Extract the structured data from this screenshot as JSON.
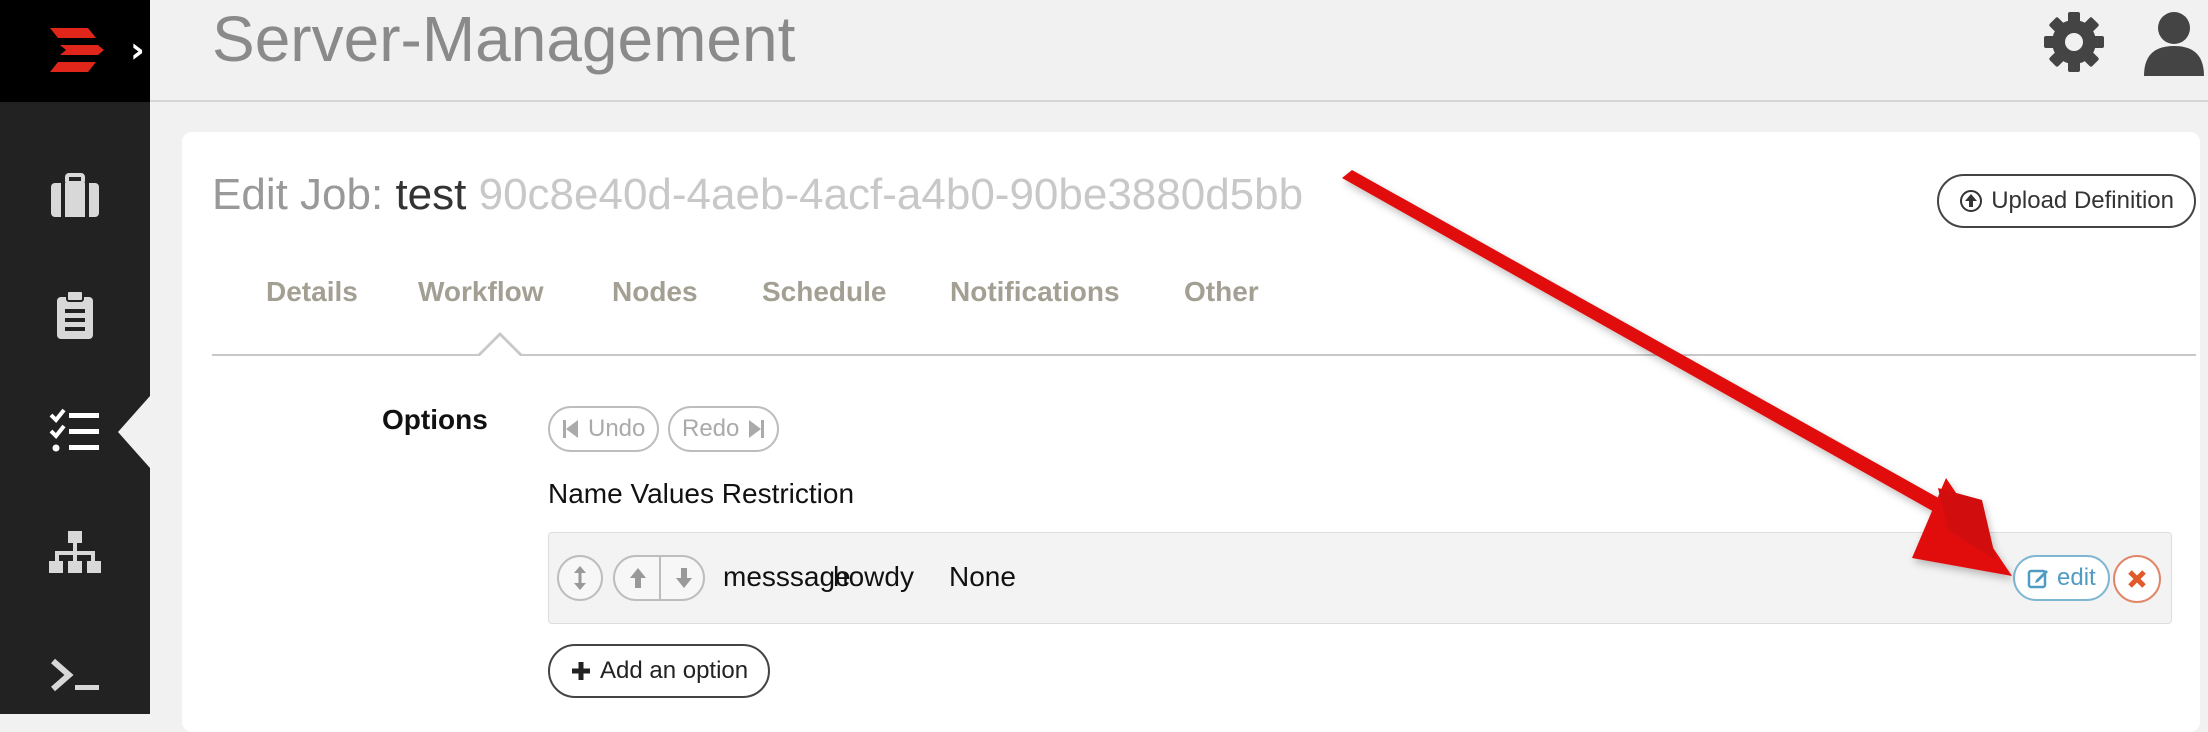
{
  "header": {
    "title": "Server-Management",
    "settings_icon": "gear-icon",
    "user_icon": "user-icon"
  },
  "sidebar": {
    "items": [
      {
        "icon": "briefcase-icon",
        "active": false
      },
      {
        "icon": "clipboard-icon",
        "active": false
      },
      {
        "icon": "task-list-icon",
        "active": true
      },
      {
        "icon": "sitemap-icon",
        "active": false
      },
      {
        "icon": "terminal-icon",
        "active": false
      }
    ]
  },
  "job": {
    "title_prefix": "Edit Job:",
    "name": "test",
    "uuid": "90c8e40d-4aeb-4acf-a4b0-90be3880d5bb",
    "upload_label": "Upload Definition"
  },
  "tabs": [
    {
      "label": "Details"
    },
    {
      "label": "Workflow",
      "active": true
    },
    {
      "label": "Nodes"
    },
    {
      "label": "Schedule"
    },
    {
      "label": "Notifications"
    },
    {
      "label": "Other"
    }
  ],
  "options": {
    "label": "Options",
    "undo_label": "Undo",
    "redo_label": "Redo",
    "column_header": "Name Values Restriction",
    "rows": [
      {
        "name": "messsage",
        "values": "howdy",
        "restriction": "None",
        "edit_label": "edit"
      }
    ],
    "add_label": "Add an option"
  },
  "colors": {
    "sidebar_bg": "#222222",
    "accent_red": "#e0261b",
    "edit_blue": "#4f9bc2",
    "delete_orange": "#e05a2b",
    "annotation_arrow": "#e1110f"
  }
}
